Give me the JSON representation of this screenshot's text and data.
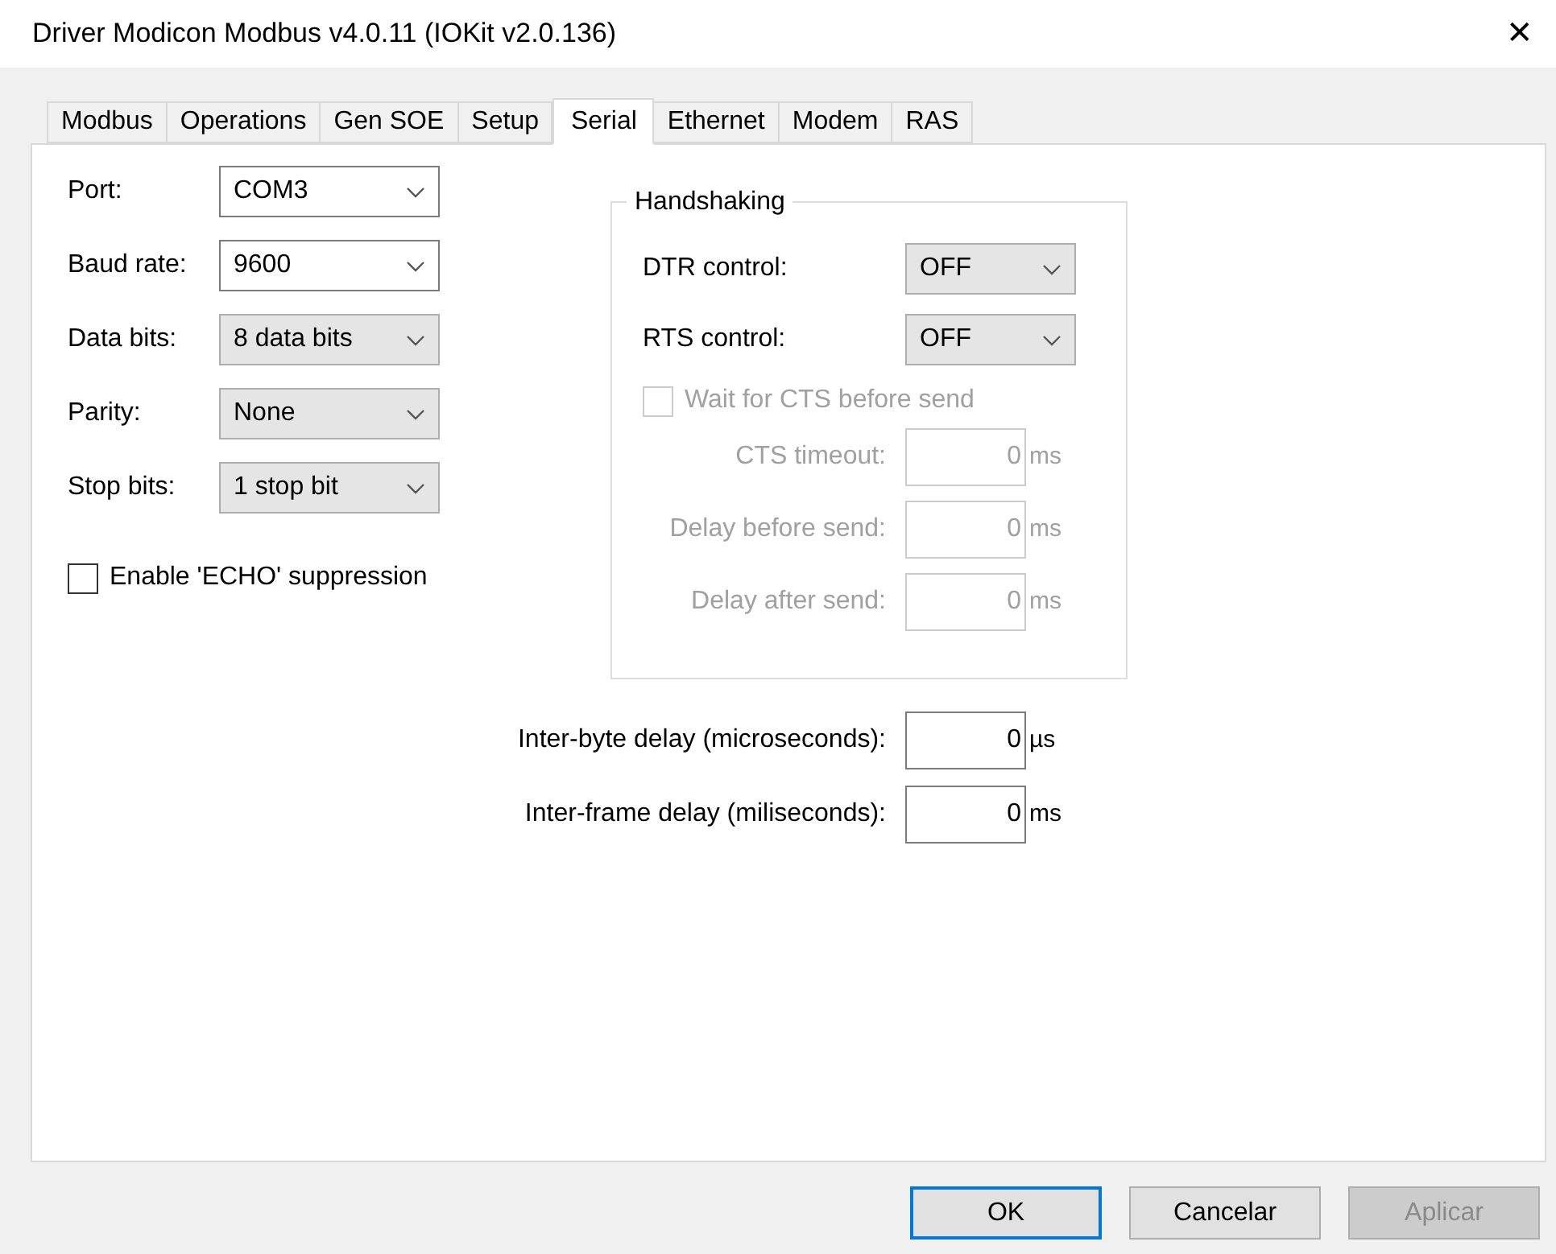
{
  "window": {
    "title": "Driver Modicon Modbus v4.0.11 (IOKit v2.0.136)",
    "close": "✕"
  },
  "tabs": [
    {
      "label": "Modbus",
      "selected": false
    },
    {
      "label": "Operations",
      "selected": false
    },
    {
      "label": "Gen SOE",
      "selected": false
    },
    {
      "label": "Setup",
      "selected": false
    },
    {
      "label": "Serial",
      "selected": true
    },
    {
      "label": "Ethernet",
      "selected": false
    },
    {
      "label": "Modem",
      "selected": false
    },
    {
      "label": "RAS",
      "selected": false
    }
  ],
  "serial": [
    {
      "label": "Port:",
      "value": "COM3",
      "kind": "editable"
    },
    {
      "label": "Baud rate:",
      "value": "9600",
      "kind": "editable"
    },
    {
      "label": "Data bits:",
      "value": "8 data bits",
      "kind": "list"
    },
    {
      "label": "Parity:",
      "value": "None",
      "kind": "list"
    },
    {
      "label": "Stop bits:",
      "value": "1 stop bit",
      "kind": "list"
    }
  ],
  "echo": {
    "label": "Enable 'ECHO' suppression",
    "checked": false,
    "disabled": false
  },
  "handshaking": {
    "title": "Handshaking",
    "controls": [
      {
        "label": "DTR control:",
        "value": "OFF"
      },
      {
        "label": "RTS control:",
        "value": "OFF"
      }
    ],
    "wait_cts": {
      "label": "Wait for CTS before send",
      "checked": false,
      "disabled": true
    },
    "fields": [
      {
        "label": "CTS timeout:",
        "value": "0",
        "unit": "ms",
        "disabled": true
      },
      {
        "label": "Delay before send:",
        "value": "0",
        "unit": "ms",
        "disabled": true
      },
      {
        "label": "Delay after send:",
        "value": "0",
        "unit": "ms",
        "disabled": true
      }
    ]
  },
  "delays": [
    {
      "label": "Inter-byte delay (microseconds):",
      "value": "0",
      "unit": "µs",
      "disabled": false
    },
    {
      "label": "Inter-frame delay (miliseconds):",
      "value": "0",
      "unit": "ms",
      "disabled": false
    }
  ],
  "buttons": [
    {
      "label": "OK",
      "kind": "default",
      "disabled": false
    },
    {
      "label": "Cancelar",
      "kind": "normal",
      "disabled": false
    },
    {
      "label": "Aplicar",
      "kind": "normal",
      "disabled": true
    }
  ]
}
